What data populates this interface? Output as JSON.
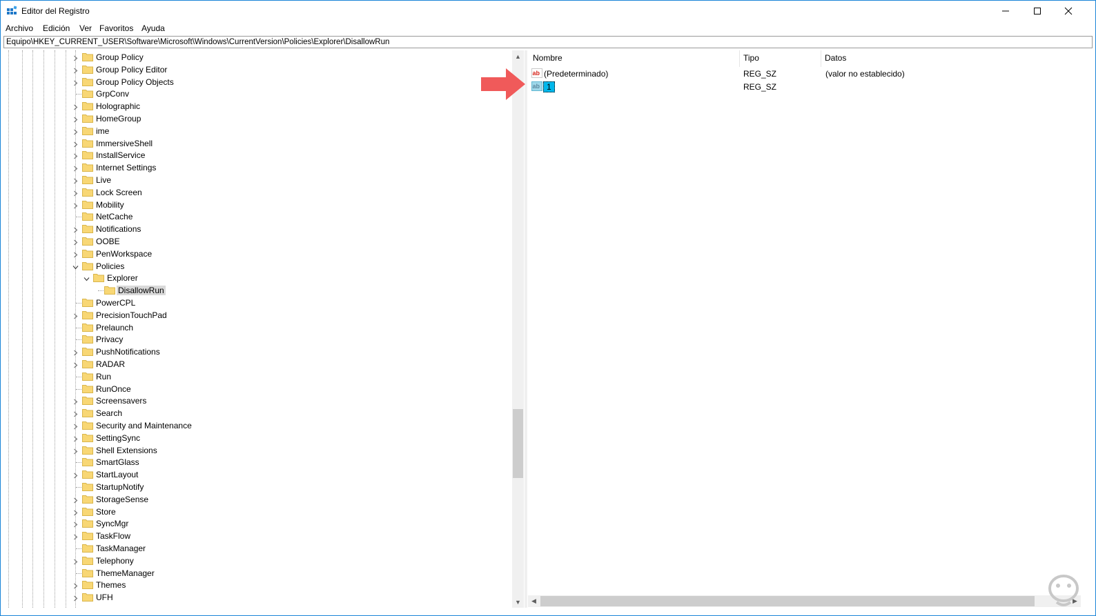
{
  "window": {
    "title": "Editor del Registro",
    "app_icon": "regedit-icon",
    "controls": [
      "minimize-icon",
      "maximize-icon",
      "close-icon"
    ]
  },
  "menu": [
    "Archivo",
    "Edición",
    "Ver",
    "Favoritos",
    "Ayuda"
  ],
  "address": "Equipo\\HKEY_CURRENT_USER\\Software\\Microsoft\\Windows\\CurrentVersion\\Policies\\Explorer\\DisallowRun",
  "tree": [
    {
      "label": "Group Policy",
      "level": 0,
      "expander": "collapsed"
    },
    {
      "label": "Group Policy Editor",
      "level": 0,
      "expander": "collapsed"
    },
    {
      "label": "Group Policy Objects",
      "level": 0,
      "expander": "collapsed"
    },
    {
      "label": "GrpConv",
      "level": 0,
      "expander": "none"
    },
    {
      "label": "Holographic",
      "level": 0,
      "expander": "collapsed"
    },
    {
      "label": "HomeGroup",
      "level": 0,
      "expander": "collapsed"
    },
    {
      "label": "ime",
      "level": 0,
      "expander": "collapsed"
    },
    {
      "label": "ImmersiveShell",
      "level": 0,
      "expander": "collapsed"
    },
    {
      "label": "InstallService",
      "level": 0,
      "expander": "collapsed"
    },
    {
      "label": "Internet Settings",
      "level": 0,
      "expander": "collapsed"
    },
    {
      "label": "Live",
      "level": 0,
      "expander": "collapsed"
    },
    {
      "label": "Lock Screen",
      "level": 0,
      "expander": "collapsed"
    },
    {
      "label": "Mobility",
      "level": 0,
      "expander": "collapsed"
    },
    {
      "label": "NetCache",
      "level": 0,
      "expander": "none"
    },
    {
      "label": "Notifications",
      "level": 0,
      "expander": "collapsed"
    },
    {
      "label": "OOBE",
      "level": 0,
      "expander": "collapsed"
    },
    {
      "label": "PenWorkspace",
      "level": 0,
      "expander": "collapsed"
    },
    {
      "label": "Policies",
      "level": 0,
      "expander": "expanded"
    },
    {
      "label": "Explorer",
      "level": 1,
      "expander": "expanded"
    },
    {
      "label": "DisallowRun",
      "level": 2,
      "expander": "none",
      "selected": true
    },
    {
      "label": "PowerCPL",
      "level": 0,
      "expander": "none"
    },
    {
      "label": "PrecisionTouchPad",
      "level": 0,
      "expander": "collapsed"
    },
    {
      "label": "Prelaunch",
      "level": 0,
      "expander": "none"
    },
    {
      "label": "Privacy",
      "level": 0,
      "expander": "none"
    },
    {
      "label": "PushNotifications",
      "level": 0,
      "expander": "collapsed"
    },
    {
      "label": "RADAR",
      "level": 0,
      "expander": "collapsed"
    },
    {
      "label": "Run",
      "level": 0,
      "expander": "none"
    },
    {
      "label": "RunOnce",
      "level": 0,
      "expander": "none"
    },
    {
      "label": "Screensavers",
      "level": 0,
      "expander": "collapsed"
    },
    {
      "label": "Search",
      "level": 0,
      "expander": "collapsed"
    },
    {
      "label": "Security and Maintenance",
      "level": 0,
      "expander": "collapsed"
    },
    {
      "label": "SettingSync",
      "level": 0,
      "expander": "collapsed"
    },
    {
      "label": "Shell Extensions",
      "level": 0,
      "expander": "collapsed"
    },
    {
      "label": "SmartGlass",
      "level": 0,
      "expander": "none"
    },
    {
      "label": "StartLayout",
      "level": 0,
      "expander": "collapsed"
    },
    {
      "label": "StartupNotify",
      "level": 0,
      "expander": "none"
    },
    {
      "label": "StorageSense",
      "level": 0,
      "expander": "collapsed"
    },
    {
      "label": "Store",
      "level": 0,
      "expander": "collapsed"
    },
    {
      "label": "SyncMgr",
      "level": 0,
      "expander": "collapsed"
    },
    {
      "label": "TaskFlow",
      "level": 0,
      "expander": "collapsed"
    },
    {
      "label": "TaskManager",
      "level": 0,
      "expander": "none"
    },
    {
      "label": "Telephony",
      "level": 0,
      "expander": "collapsed"
    },
    {
      "label": "ThemeManager",
      "level": 0,
      "expander": "none"
    },
    {
      "label": "Themes",
      "level": 0,
      "expander": "collapsed"
    },
    {
      "label": "UFH",
      "level": 0,
      "expander": "collapsed"
    }
  ],
  "list": {
    "columns": [
      "Nombre",
      "Tipo",
      "Datos"
    ],
    "rows": [
      {
        "name": "(Predeterminado)",
        "type": "REG_SZ",
        "data": "(valor no establecido)",
        "icon": "reg-string-icon",
        "editing": false
      },
      {
        "name": "1",
        "type": "REG_SZ",
        "data": "",
        "icon": "reg-string-icon",
        "editing": true
      }
    ]
  },
  "annotation": {
    "icon": "red-arrow-icon",
    "color": "#f05a5a"
  },
  "colors": {
    "window_border": "#1883d7",
    "selection": "#d9d9d9",
    "edit_highlight": "#00b7eb",
    "folder": "#f8d775"
  }
}
